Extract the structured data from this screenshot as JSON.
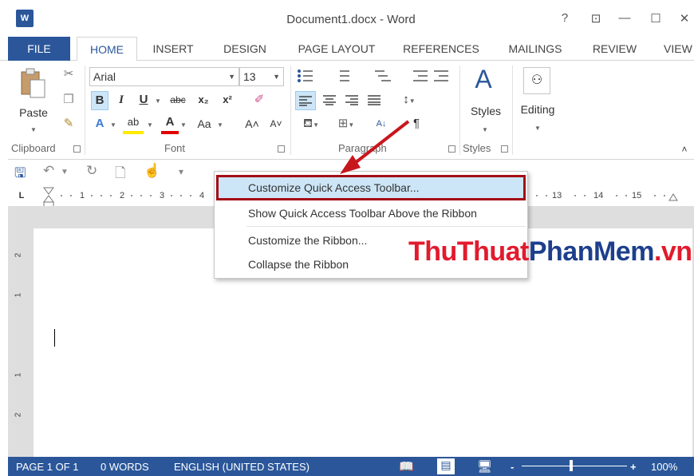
{
  "window": {
    "title": "Document1.docx - Word",
    "logo": "W",
    "help": "?",
    "ribbon_display": "⊡",
    "minimize": "—",
    "maximize": "☐",
    "close": "✕"
  },
  "tabs": [
    {
      "label": "FILE"
    },
    {
      "label": "HOME"
    },
    {
      "label": "INSERT"
    },
    {
      "label": "DESIGN"
    },
    {
      "label": "PAGE LAYOUT"
    },
    {
      "label": "REFERENCES"
    },
    {
      "label": "MAILINGS"
    },
    {
      "label": "REVIEW"
    },
    {
      "label": "VIEW"
    }
  ],
  "ribbon": {
    "clipboard": {
      "paste_label": "Paste",
      "group_label": "Clipboard"
    },
    "font": {
      "name": "Arial",
      "size": "13",
      "group_label": "Font",
      "bold": "B",
      "italic": "I",
      "underline": "U",
      "strike": "abc",
      "subscript": "x₂",
      "superscript": "x²",
      "change_case": "Aa",
      "grow": "A˄",
      "shrink": "A˅",
      "text_effects": "A",
      "highlight": "ab",
      "font_color": "A"
    },
    "paragraph": {
      "group_label": "Paragraph",
      "pilcrow": "¶"
    },
    "styles": {
      "label": "Styles",
      "group_label": "Styles"
    },
    "editing": {
      "label": "Editing"
    }
  },
  "ruler": {
    "numbers": [
      "1",
      "2",
      "3",
      "4",
      "13",
      "14",
      "15"
    ],
    "tab_stop": "L"
  },
  "vertical_ruler": {
    "numbers": [
      "2",
      "1",
      "1",
      "2"
    ]
  },
  "context_menu": {
    "items": [
      {
        "label": "Customize Quick Access Toolbar..."
      },
      {
        "label": "Show Quick Access Toolbar Above the Ribbon"
      },
      {
        "label": "Customize the Ribbon..."
      },
      {
        "label": "Collapse the Ribbon"
      }
    ]
  },
  "watermark": {
    "part1": "ThuThuat",
    "part2": "PhanMem",
    "part3": ".vn"
  },
  "statusbar": {
    "page": "PAGE 1 OF 1",
    "words": "0 WORDS",
    "language": "ENGLISH (UNITED STATES)",
    "zoom_minus": "-",
    "zoom_plus": "+",
    "zoom": "100%"
  },
  "colors": {
    "accent": "#2b579a",
    "highlight_border": "#a40c14",
    "watermark_red": "#e11b2d",
    "watermark_blue": "#1d3f8d"
  }
}
